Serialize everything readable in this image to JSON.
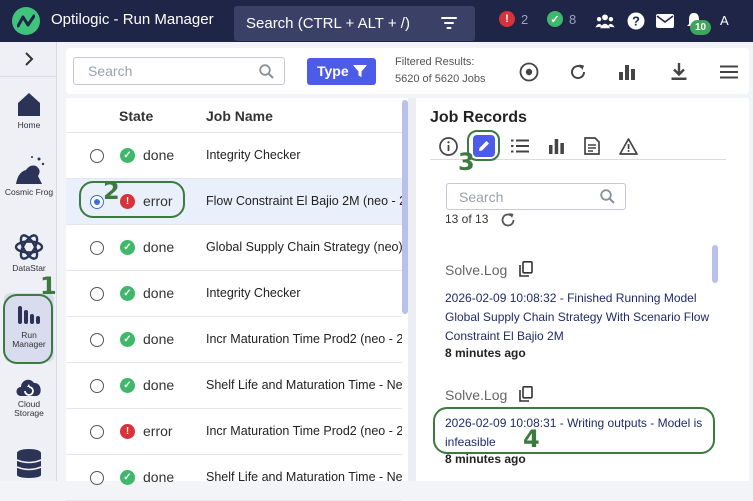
{
  "header": {
    "app_title": "Optilogic - Run Manager",
    "search_label": "Search (CTRL + ALT + /)",
    "error_count": "2",
    "done_count": "8",
    "notification_count": "10",
    "user_initial": "A"
  },
  "sidebar": {
    "items": [
      {
        "label": "Home"
      },
      {
        "label": "Cosmic Frog"
      },
      {
        "label": "DataStar"
      },
      {
        "label": "Run Manager"
      },
      {
        "label": "Cloud Storage"
      }
    ]
  },
  "toolbar": {
    "search_placeholder": "Search",
    "type_label": "Type",
    "filtered_label": "Filtered Results:",
    "filtered_value": "5620 of 5620 Jobs"
  },
  "jobs": {
    "col_state": "State",
    "col_name": "Job Name",
    "rows": [
      {
        "state": "done",
        "name": "Integrity Checker"
      },
      {
        "state": "error",
        "name": "Flow Constraint El Bajio 2M (neo - 20"
      },
      {
        "state": "done",
        "name": "Global Supply Chain Strategy (neo) - F"
      },
      {
        "state": "done",
        "name": "Integrity Checker"
      },
      {
        "state": "done",
        "name": "Incr Maturation Time Prod2 (neo - 20"
      },
      {
        "state": "done",
        "name": "Shelf Life and Maturation Time - Neo"
      },
      {
        "state": "error",
        "name": "Incr Maturation Time Prod2 (neo - 20"
      },
      {
        "state": "done",
        "name": "Shelf Life and Maturation Time - Neo"
      }
    ]
  },
  "records": {
    "title": "Job Records",
    "search_placeholder": "Search",
    "count": "13 of 13",
    "logs": [
      {
        "title": "Solve.Log",
        "message": "2026-02-09 10:08:32 - Finished Running Model Global Supply Chain Strategy With Scenario Flow Constraint El Bajio 2M",
        "time": "8 minutes ago"
      },
      {
        "title": "Solve.Log",
        "message": "2026-02-09 10:08:31 - Writing outputs - Model is infeasible",
        "time": "8 minutes ago"
      }
    ]
  },
  "annotations": [
    "1",
    "2",
    "3",
    "4"
  ],
  "colors": {
    "topbar": "#1f2547",
    "accent": "#4d5ce8",
    "done": "#3fb86b",
    "error": "#d8323a",
    "annotation": "#3c7a3f"
  }
}
